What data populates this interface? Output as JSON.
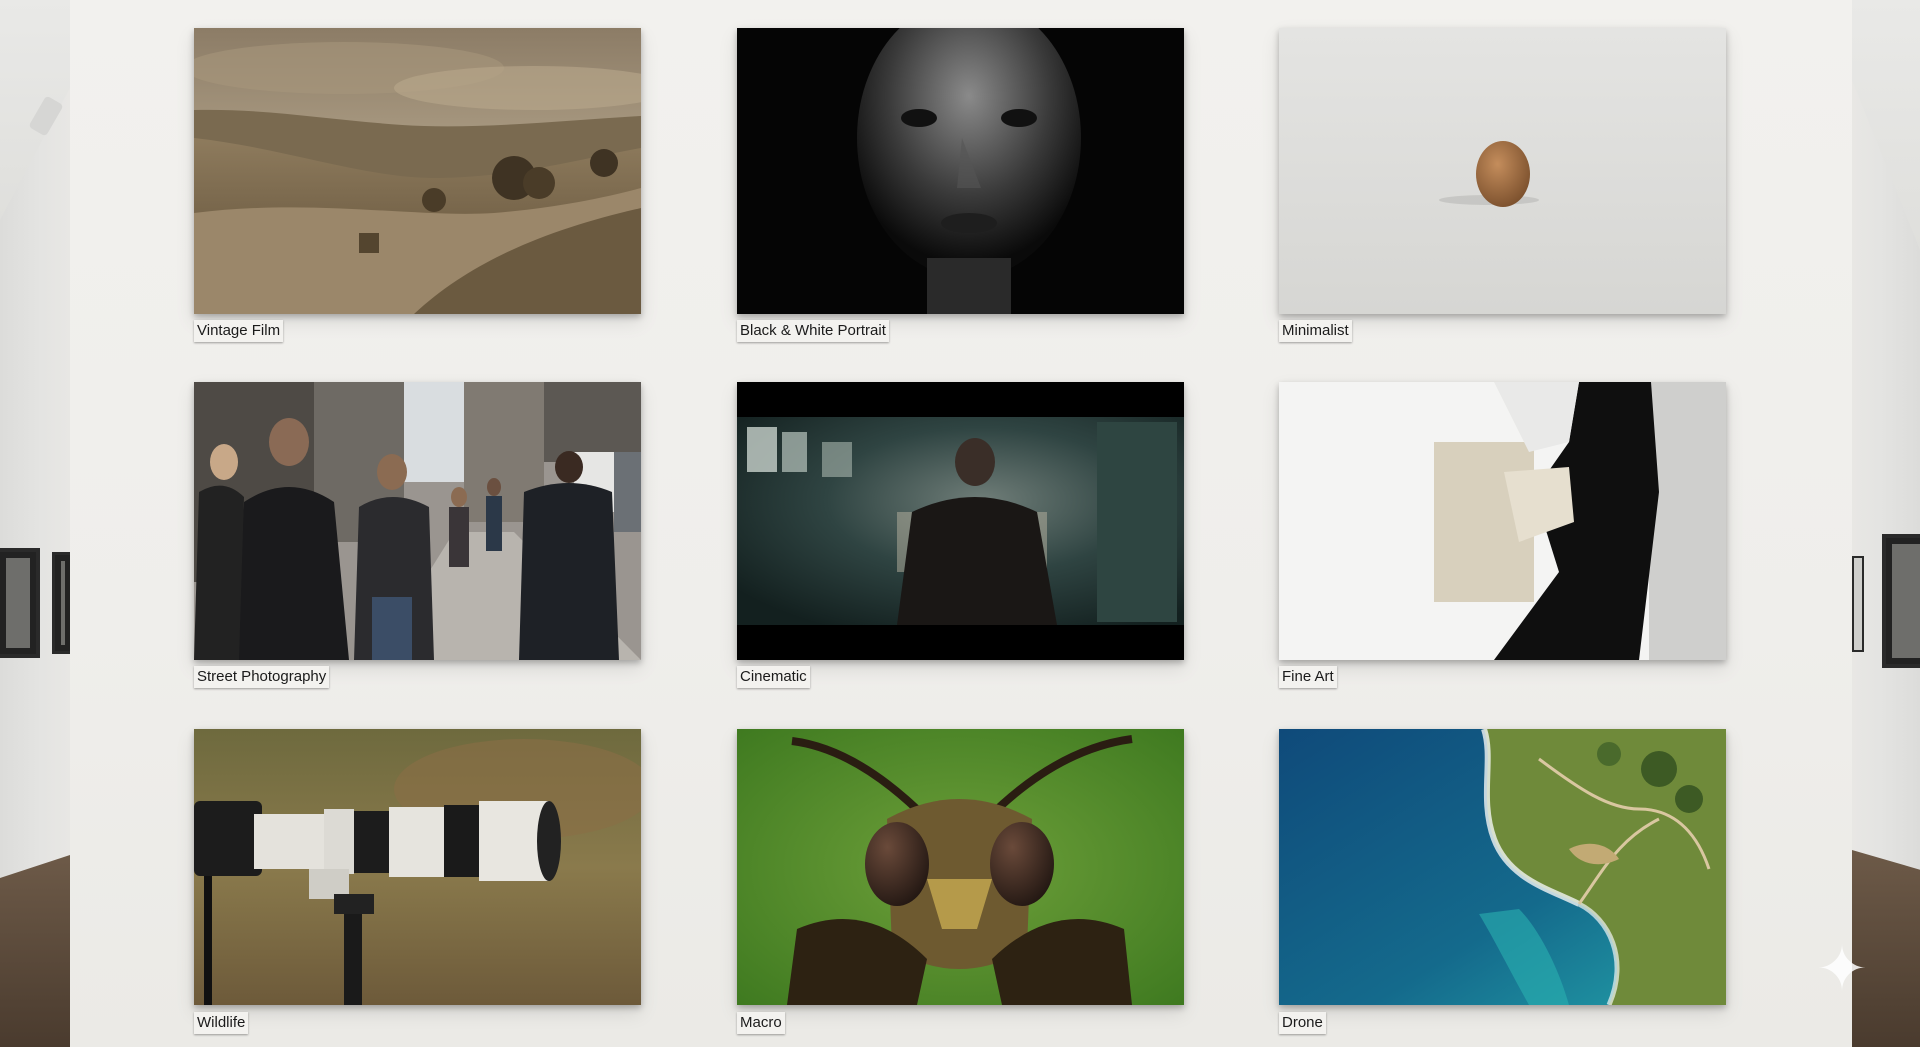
{
  "gallery": {
    "items": [
      {
        "label": "Vintage Film",
        "icon": "sepia-landscape-photo"
      },
      {
        "label": "Black & White Portrait",
        "icon": "bw-portrait-photo"
      },
      {
        "label": "Minimalist",
        "icon": "minimal-seed-photo"
      },
      {
        "label": "Street Photography",
        "icon": "street-crowd-photo"
      },
      {
        "label": "Cinematic",
        "icon": "cinematic-man-photo"
      },
      {
        "label": "Fine Art",
        "icon": "abstract-paper-photo"
      },
      {
        "label": "Wildlife",
        "icon": "telephoto-camera-photo"
      },
      {
        "label": "Macro",
        "icon": "insect-macro-photo"
      },
      {
        "label": "Drone",
        "icon": "aerial-coast-photo"
      }
    ]
  },
  "colors": {
    "wall": "#efeeeb",
    "label_bg": "#f3f2ef",
    "floor": "#5a4837"
  }
}
